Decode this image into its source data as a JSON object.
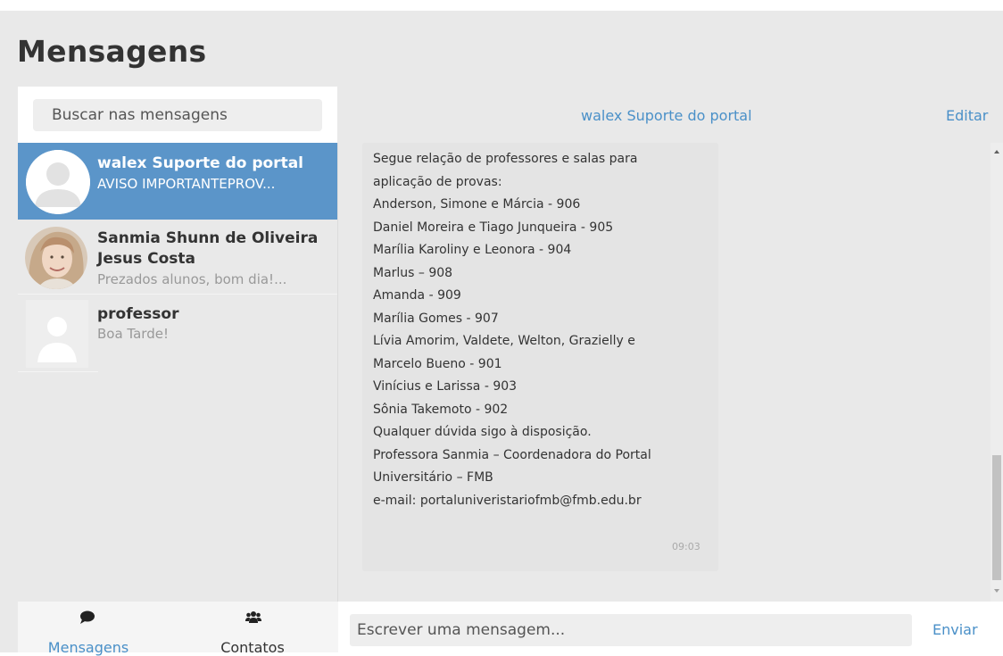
{
  "page": {
    "title": "Mensagens"
  },
  "search": {
    "placeholder": "Buscar nas mensagens"
  },
  "conversations": [
    {
      "name": "walex Suporte do portal",
      "snippet": "AVISO IMPORTANTEPROV..."
    },
    {
      "name_line1": "Sanmia Shunn de Oliveira",
      "name_line2": "Jesus Costa",
      "snippet": "Prezados alunos, bom dia!..."
    },
    {
      "name": "professor",
      "snippet": "Boa Tarde!"
    }
  ],
  "chat": {
    "contact": "walex Suporte do portal",
    "edit_label": "Editar",
    "message": {
      "lines": [
        "Segue relação de professores e salas para",
        "aplicação de provas:",
        "Anderson, Simone e Márcia - 906",
        "Daniel Moreira e Tiago Junqueira - 905",
        "Marília Karoliny e Leonora - 904",
        "Marlus – 908",
        "Amanda - 909",
        "Marília Gomes - 907",
        "Lívia Amorim, Valdete, Welton, Grazielly e",
        "Marcelo Bueno - 901",
        "Vinícius e Larissa - 903",
        "Sônia Takemoto - 902",
        "Qualquer dúvida sigo à disposição.",
        "Professora Sanmia – Coordenadora do Portal",
        "Universitário – FMB",
        "e-mail: portaluniveristariofmb@fmb.edu.br"
      ],
      "time": "09:03"
    }
  },
  "compose": {
    "placeholder": "Escrever uma mensagem...",
    "send_label": "Enviar"
  },
  "nav": {
    "messages": {
      "label": "Mensagens",
      "icon": "speech-bubble-icon",
      "color": "#4a90c8"
    },
    "contacts": {
      "label": "Contatos",
      "icon": "users-icon",
      "color": "#333333"
    }
  },
  "colors": {
    "accent": "#5b95c9",
    "link": "#4a90c8"
  }
}
